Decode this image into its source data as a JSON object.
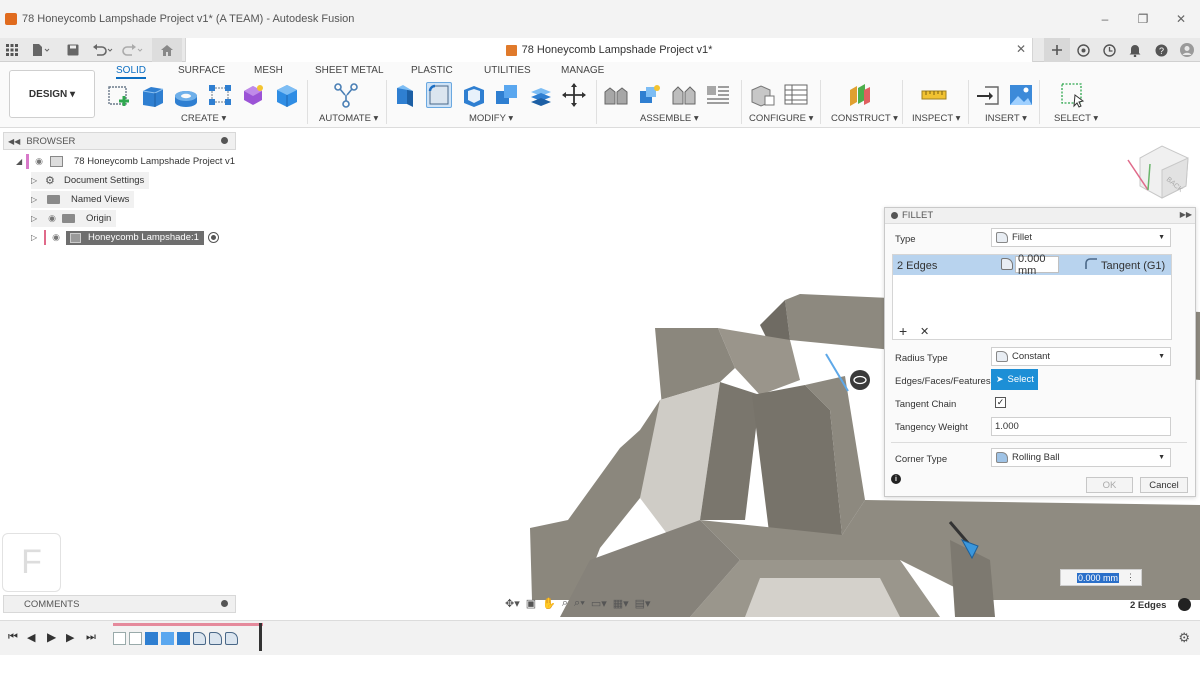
{
  "window": {
    "title": "78 Honeycomb Lampshade Project v1* (A TEAM) - Autodesk Fusion",
    "controls": [
      "–",
      "❐",
      "✕"
    ]
  },
  "document_tab": {
    "title": "78 Honeycomb Lampshade Project v1*",
    "close": "✕"
  },
  "workspace": {
    "design_label": "DESIGN ▾"
  },
  "ribbon_tabs": [
    "SOLID",
    "SURFACE",
    "MESH",
    "SHEET METAL",
    "PLASTIC",
    "UTILITIES",
    "MANAGE"
  ],
  "ribbon_groups": [
    "CREATE ▾",
    "AUTOMATE ▾",
    "MODIFY ▾",
    "ASSEMBLE ▾",
    "CONFIGURE ▾",
    "CONSTRUCT ▾",
    "INSPECT ▾",
    "INSERT ▾",
    "SELECT ▾"
  ],
  "browser": {
    "title": "BROWSER",
    "root": "78 Honeycomb Lampshade Project v1",
    "items": [
      "Document Settings",
      "Named Views",
      "Origin",
      "Honeycomb Lampshade:1"
    ]
  },
  "fillet": {
    "title": "FILLET",
    "type_label": "Type",
    "type_value": "Fillet",
    "edges_label": "2 Edges",
    "radius_value": "0.000 mm",
    "continuity": "Tangent (G1)",
    "add": "+",
    "remove": "✕",
    "radius_type_label": "Radius Type",
    "radius_type_value": "Constant",
    "edges_faces_label": "Edges/Faces/Features",
    "select_label": "Select",
    "tangent_chain_label": "Tangent Chain",
    "tangent_chain_checked": true,
    "tangency_weight_label": "Tangency Weight",
    "tangency_weight_value": "1.000",
    "corner_type_label": "Corner Type",
    "corner_type_value": "Rolling Ball",
    "ok_label": "OK",
    "cancel_label": "Cancel"
  },
  "canvas": {
    "radius_input": "0.000 mm",
    "status": "2 Edges",
    "viewcube_face": "BACK"
  },
  "comments": {
    "title": "COMMENTS"
  },
  "logo_letter": "F",
  "colors": {
    "accent": "#0b6ec2",
    "select_button": "#1d8fd6",
    "model": "#7b776e",
    "row_highlight": "#b8d3ee"
  }
}
